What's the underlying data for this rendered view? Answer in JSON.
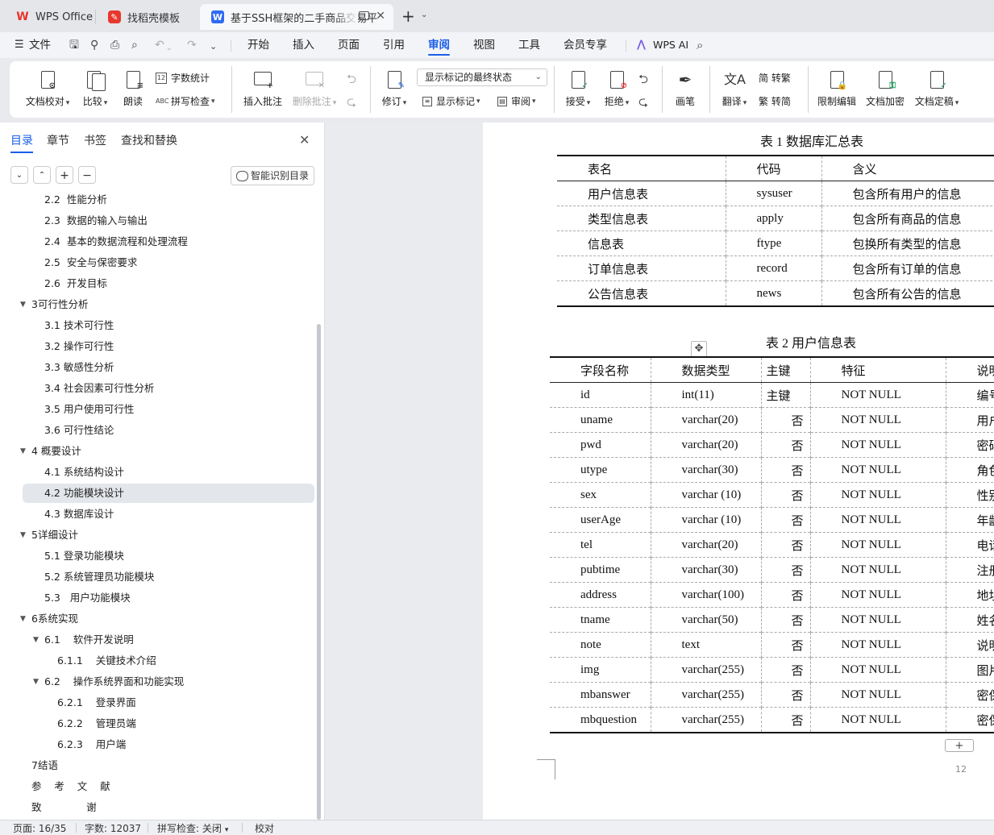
{
  "tabs": [
    {
      "label": "WPS Office",
      "icon": "wps-logo-icon"
    },
    {
      "label": "找稻壳模板",
      "icon": "docer-logo-icon"
    },
    {
      "label": "基于SSH框架的二手商品交易平",
      "icon": "writer-doc-icon"
    }
  ],
  "menu": {
    "file": "文件",
    "items": [
      "开始",
      "插入",
      "页面",
      "引用",
      "审阅",
      "视图",
      "工具",
      "会员专享"
    ],
    "active": "审阅",
    "ai": "WPS AI"
  },
  "ribbon": {
    "doc_check": "文档校对",
    "compare": "比较",
    "read_aloud": "朗读",
    "word_count": "字数统计",
    "spell_check": "拼写检查",
    "insert_comment": "插入批注",
    "delete_comment": "删除批注",
    "track": "修订",
    "markup_state": "显示标记的最终状态",
    "show_markup": "显示标记",
    "review": "审阅",
    "accept": "接受",
    "reject": "拒绝",
    "pen": "画笔",
    "translate": "翻译",
    "to_traditional": "简 转繁",
    "to_simplified": "繁 转简",
    "restrict_edit": "限制编辑",
    "encrypt": "文档加密",
    "finalize": "文档定稿"
  },
  "nav": {
    "tabs": [
      "目录",
      "章节",
      "书签",
      "查找和替换"
    ],
    "active_tab": "目录",
    "smart_toc": "智能识别目录",
    "toc": [
      {
        "text": "2.2  性能分析",
        "indent": 2,
        "caret": ""
      },
      {
        "text": "2.3  数据的输入与输出",
        "indent": 2,
        "caret": ""
      },
      {
        "text": "2.4  基本的数据流程和处理流程",
        "indent": 2,
        "caret": ""
      },
      {
        "text": "2.5  安全与保密要求",
        "indent": 2,
        "caret": ""
      },
      {
        "text": "2.6  开发目标",
        "indent": 2,
        "caret": ""
      },
      {
        "text": "3可行性分析",
        "indent": 1,
        "caret": "▼"
      },
      {
        "text": "3.1 技术可行性",
        "indent": 2,
        "caret": ""
      },
      {
        "text": "3.2 操作可行性",
        "indent": 2,
        "caret": ""
      },
      {
        "text": "3.3 敏感性分析",
        "indent": 2,
        "caret": ""
      },
      {
        "text": "3.4 社会因素可行性分析",
        "indent": 2,
        "caret": ""
      },
      {
        "text": "3.5 用户使用可行性",
        "indent": 2,
        "caret": ""
      },
      {
        "text": "3.6 可行性结论",
        "indent": 2,
        "caret": ""
      },
      {
        "text": "4 概要设计",
        "indent": 1,
        "caret": "▼"
      },
      {
        "text": "4.1 系统结构设计",
        "indent": 2,
        "caret": ""
      },
      {
        "text": "4.2 功能模块设计",
        "indent": 2,
        "caret": "",
        "selected": true
      },
      {
        "text": "4.3 数据库设计",
        "indent": 2,
        "caret": ""
      },
      {
        "text": "5详细设计",
        "indent": 1,
        "caret": "▼"
      },
      {
        "text": "5.1 登录功能模块",
        "indent": 2,
        "caret": ""
      },
      {
        "text": "5.2 系统管理员功能模块",
        "indent": 2,
        "caret": ""
      },
      {
        "text": "5.3   用户功能模块",
        "indent": 2,
        "caret": ""
      },
      {
        "text": "6系统实现",
        "indent": 1,
        "caret": "▼"
      },
      {
        "text": "6.1    软件开发说明",
        "indent": 2,
        "caret": "▼"
      },
      {
        "text": "6.1.1    关键技术介绍",
        "indent": 3,
        "caret": ""
      },
      {
        "text": "6.2    操作系统界面和功能实现",
        "indent": 2,
        "caret": "▼"
      },
      {
        "text": "6.2.1    登录界面",
        "indent": 3,
        "caret": ""
      },
      {
        "text": "6.2.2    管理员端",
        "indent": 3,
        "caret": ""
      },
      {
        "text": "6.2.3    用户端",
        "indent": 3,
        "caret": ""
      },
      {
        "text": "7结语",
        "indent": 1,
        "caret": ""
      },
      {
        "text": "参    考    文    献",
        "indent": 1,
        "caret": ""
      },
      {
        "text": "致              谢",
        "indent": 1,
        "caret": ""
      }
    ]
  },
  "document": {
    "table1": {
      "caption": "表 1  数据库汇总表",
      "headers": [
        "表名",
        "代码",
        "含义"
      ],
      "rows": [
        [
          "用户信息表",
          "sysuser",
          "包含所有用户的信息"
        ],
        [
          "类型信息表",
          "apply",
          "包含所有商品的信息"
        ],
        [
          "信息表",
          "ftype",
          "包换所有类型的信息"
        ],
        [
          "订单信息表",
          "record",
          "包含所有订单的信息"
        ],
        [
          "公告信息表",
          "news",
          "包含所有公告的信息"
        ]
      ]
    },
    "table2": {
      "caption": "表 2  用户信息表",
      "headers": [
        "字段名称",
        "数据类型",
        "主键",
        "特征",
        "说明"
      ],
      "rows": [
        [
          "id",
          "int(11)",
          "主键",
          "NOT NULL",
          "编号"
        ],
        [
          "uname",
          "varchar(20)",
          "否",
          "NOT NULL",
          "用户"
        ],
        [
          "pwd",
          "varchar(20)",
          "否",
          "NOT NULL",
          "密码"
        ],
        [
          "utype",
          "varchar(30)",
          "否",
          "NOT NULL",
          "角色"
        ],
        [
          "sex",
          "varchar (10)",
          "否",
          "NOT NULL",
          "性别"
        ],
        [
          "userAge",
          "varchar (10)",
          "否",
          "NOT NULL",
          "年龄"
        ],
        [
          "tel",
          "varchar(20)",
          "否",
          "NOT NULL",
          "电话"
        ],
        [
          "pubtime",
          "varchar(30)",
          "否",
          "NOT NULL",
          "注册"
        ],
        [
          "address",
          "varchar(100)",
          "否",
          "NOT NULL",
          "地址"
        ],
        [
          "tname",
          "varchar(50)",
          "否",
          "NOT NULL",
          "姓名"
        ],
        [
          "note",
          "text",
          "否",
          "NOT NULL",
          "说明"
        ],
        [
          "img",
          "varchar(255)",
          "否",
          "NOT NULL",
          "图片"
        ],
        [
          "mbanswer",
          "varchar(255)",
          "否",
          "NOT NULL",
          "密保"
        ],
        [
          "mbquestion",
          "varchar(255)",
          "否",
          "NOT NULL",
          "密保"
        ]
      ]
    },
    "page_number": "12"
  },
  "status": {
    "page": "页面: 16/35",
    "words": "字数: 12037",
    "spell": "拼写检查: 关闭",
    "proof": "校对"
  },
  "colors": {
    "accent": "#1b5ee8",
    "wps_red": "#e8332a",
    "docer_red": "#e8372c",
    "writer_blue": "#2f6bf2"
  }
}
